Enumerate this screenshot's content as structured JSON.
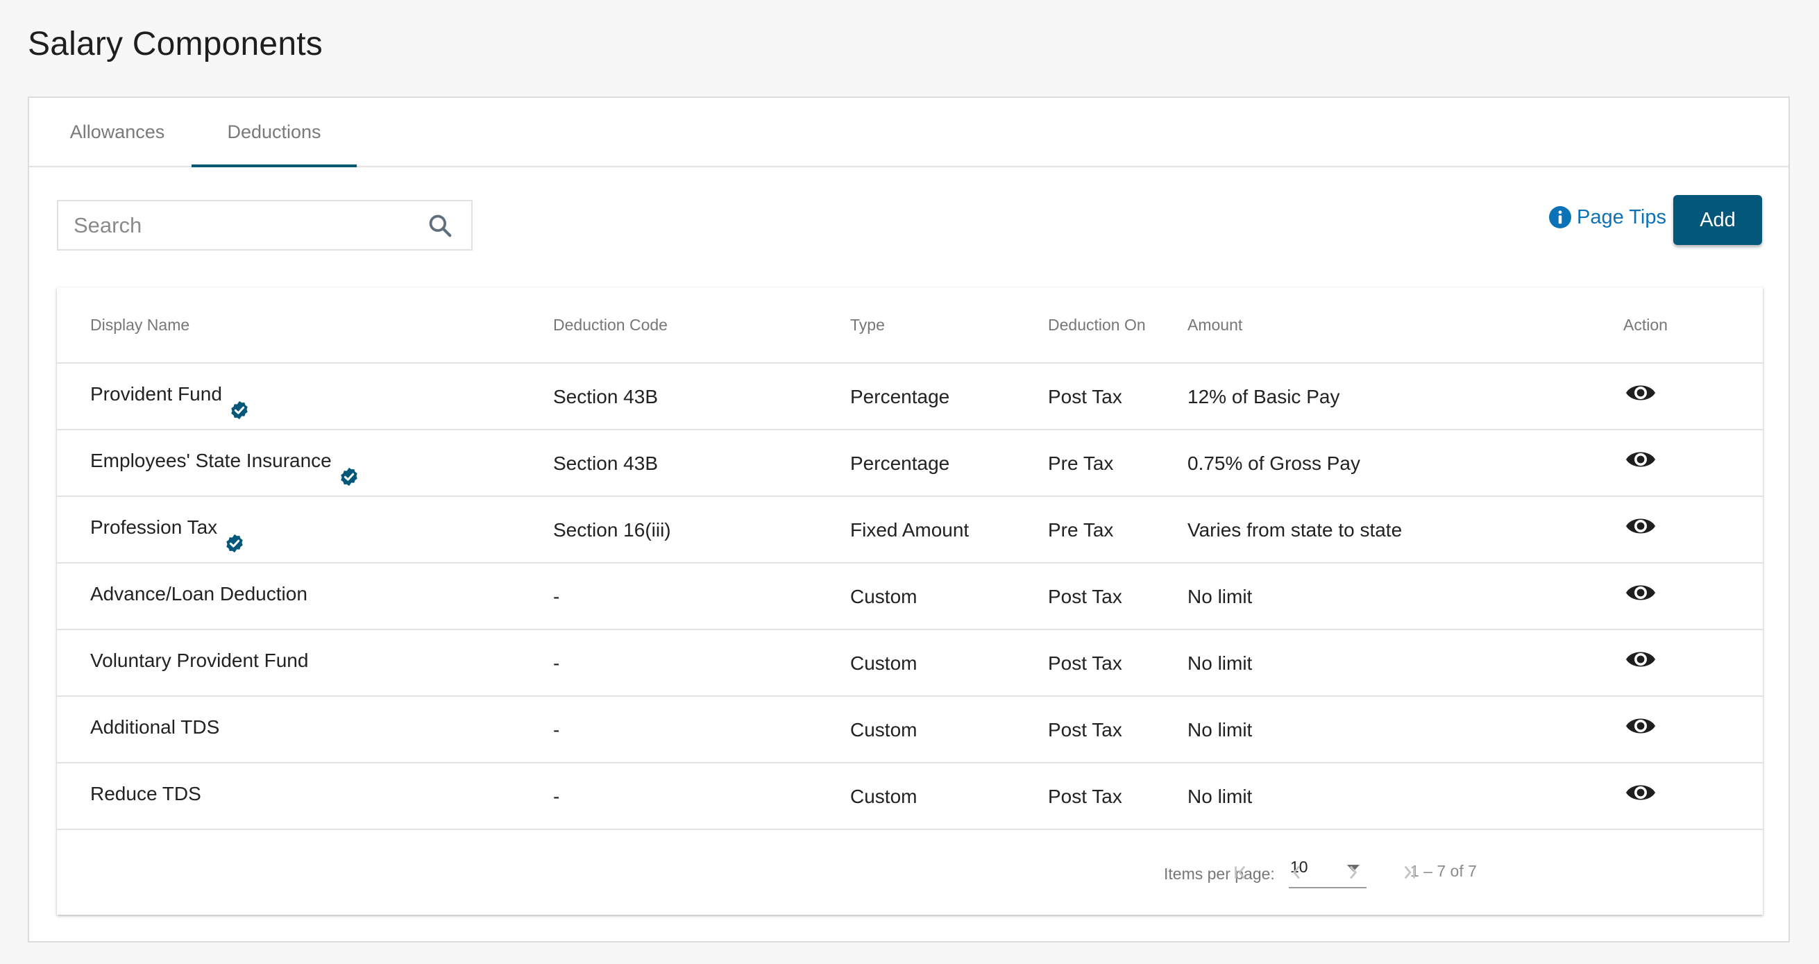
{
  "page": {
    "title": "Salary Components"
  },
  "tabs": [
    {
      "label": "Allowances",
      "active": false
    },
    {
      "label": "Deductions",
      "active": true
    }
  ],
  "toolbar": {
    "search_placeholder": "Search",
    "search_value": "",
    "page_tips_label": "Page Tips",
    "add_label": "Add"
  },
  "table": {
    "columns": [
      "Display Name",
      "Deduction Code",
      "Type",
      "Deduction On",
      "Amount",
      "Action"
    ],
    "rows": [
      {
        "name": "Provident Fund",
        "verified": true,
        "code": "Section 43B",
        "type": "Percentage",
        "on": "Post Tax",
        "amount": "12% of Basic Pay",
        "action": "view"
      },
      {
        "name": "Employees' State Insurance",
        "verified": true,
        "code": "Section 43B",
        "type": "Percentage",
        "on": "Pre Tax",
        "amount": "0.75% of Gross Pay",
        "action": "view"
      },
      {
        "name": "Profession Tax",
        "verified": true,
        "code": "Section 16(iii)",
        "type": "Fixed Amount",
        "on": "Pre Tax",
        "amount": "Varies from state to state",
        "action": "view"
      },
      {
        "name": "Advance/Loan Deduction",
        "verified": false,
        "code": "-",
        "type": "Custom",
        "on": "Post Tax",
        "amount": "No limit",
        "action": "view"
      },
      {
        "name": "Voluntary Provident Fund",
        "verified": false,
        "code": "-",
        "type": "Custom",
        "on": "Post Tax",
        "amount": "No limit",
        "action": "view"
      },
      {
        "name": "Additional TDS",
        "verified": false,
        "code": "-",
        "type": "Custom",
        "on": "Post Tax",
        "amount": "No limit",
        "action": "view"
      },
      {
        "name": "Reduce TDS",
        "verified": false,
        "code": "-",
        "type": "Custom",
        "on": "Post Tax",
        "amount": "No limit",
        "action": "view"
      }
    ]
  },
  "pagination": {
    "items_per_page_label": "Items per page:",
    "items_per_page_value": "10",
    "range_label": "1 – 7 of 7"
  },
  "colors": {
    "accent": "#02577a",
    "link": "#0c72b8"
  }
}
